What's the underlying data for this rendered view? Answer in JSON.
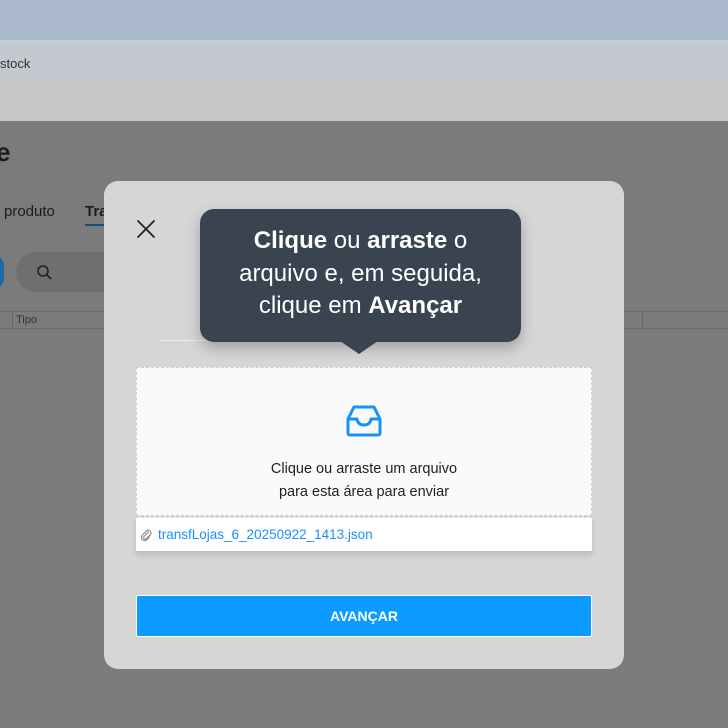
{
  "browser": {
    "tab_title": "stock"
  },
  "page": {
    "heading": "e",
    "tabs": [
      {
        "label": "produto"
      },
      {
        "label": "Tra"
      }
    ],
    "table": {
      "columns": [
        "Tipo"
      ]
    }
  },
  "modal": {
    "close_icon": "close-icon",
    "dropzone": {
      "icon": "inbox-icon",
      "line1": "Clique ou arraste um arquivo",
      "line2": "para esta área para enviar"
    },
    "uploaded_file": {
      "icon": "paperclip-icon",
      "name": "transfLojas_6_20250922_1413.json"
    },
    "next_button": "AVANÇAR"
  },
  "tooltip": {
    "line1_bold1": "Clique",
    "line1_normal": " ou ",
    "line1_bold2": "arraste",
    "line1_tail": " o",
    "line2": "arquivo e, em seguida,",
    "line3_normal": "clique em ",
    "line3_bold": "Avançar"
  },
  "colors": {
    "accent": "#0d9bff",
    "link": "#1890ff",
    "tooltip_bg": "#3a4451",
    "overlay": "#7b7b7b"
  }
}
